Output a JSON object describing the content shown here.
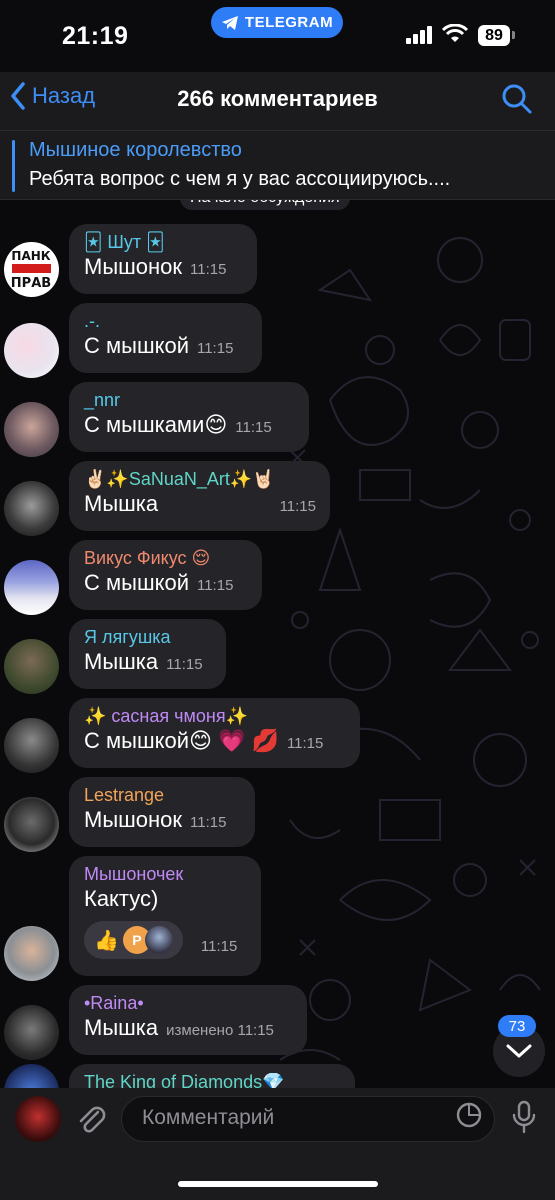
{
  "status": {
    "time": "21:19",
    "app_pill": "TELEGRAM",
    "battery": "89"
  },
  "nav": {
    "back_label": "Назад",
    "title": "266 комментариев"
  },
  "pinned": {
    "title": "Мышиное королевство",
    "text": "Ребята вопрос с чем я у вас ассоциируюсь...."
  },
  "chat": {
    "start_label": "Начало обсуждения",
    "messages": [
      {
        "sender": "🃏 Шут 🃏",
        "sender_color": "#57c8e8",
        "text": "Мышонок",
        "time": "11:15"
      },
      {
        "sender": ".-.",
        "sender_color": "#57c8e8",
        "text": "С мышкой",
        "time": "11:15"
      },
      {
        "sender": "_nnr",
        "sender_color": "#57c8e8",
        "text": "С мышками😊",
        "time": "11:15"
      },
      {
        "sender": "✌🏻✨SaNuaN_Art✨🤘🏻",
        "sender_color": "#5fd6c7",
        "text": "Мышка",
        "time": "11:15"
      },
      {
        "sender": "Викус Фикус 😌",
        "sender_color": "#ee8a6e",
        "text": "С мышкой",
        "time": "11:15"
      },
      {
        "sender": "Я лягушка",
        "sender_color": "#57c8e8",
        "text": "Мышка",
        "time": "11:15"
      },
      {
        "sender": "✨ сасная чмоня✨",
        "sender_color": "#c08af5",
        "text": "С мышкой😊 💗 💋",
        "time": "11:15"
      },
      {
        "sender": "Lestrange",
        "sender_color": "#f2a45a",
        "text": "Мышонок",
        "time": "11:15"
      },
      {
        "sender": "Мышоночек",
        "sender_color": "#c08af5",
        "text": "Кактус)",
        "time": "11:15",
        "reaction_emoji": "👍",
        "reaction_avatar_letter": "P"
      },
      {
        "sender": "•Raina•",
        "sender_color": "#c08af5",
        "text": "Мышка",
        "time": "изменено 11:15"
      },
      {
        "sender": "The King of Diamonds💎",
        "sender_color": "#5fd6c7",
        "text": "",
        "time": ""
      }
    ]
  },
  "scroll_button": {
    "unread_count": "73"
  },
  "composer": {
    "placeholder": "Комментарий"
  },
  "colors": {
    "accent": "#3e8ef7",
    "bubble": "#252428",
    "panel": "#1b1b1e"
  },
  "icons": [
    "telegram-icon",
    "signal-icon",
    "wifi-icon",
    "chevron-left-icon",
    "search-icon",
    "chevron-down-icon",
    "paperclip-icon",
    "sticker-icon",
    "microphone-icon"
  ]
}
